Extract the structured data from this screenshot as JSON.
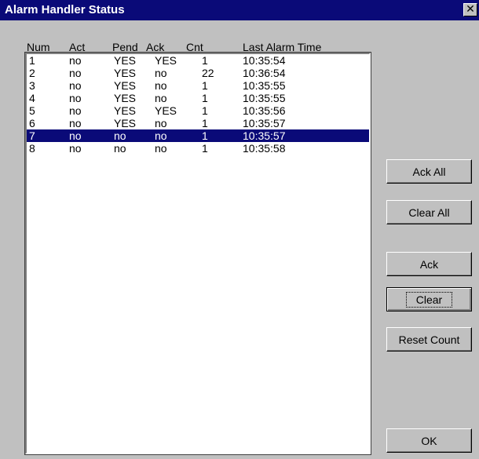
{
  "window": {
    "title": "Alarm Handler Status",
    "close_glyph": "✕"
  },
  "columns": [
    "Num",
    "Act",
    "Pend",
    "Ack",
    "Cnt",
    "Last Alarm Time"
  ],
  "rows": [
    {
      "num": "1",
      "act": "no",
      "pend": "YES",
      "ack": "YES",
      "cnt": "1",
      "time": "10:35:54"
    },
    {
      "num": "2",
      "act": "no",
      "pend": "YES",
      "ack": "no",
      "cnt": "22",
      "time": "10:36:54"
    },
    {
      "num": "3",
      "act": "no",
      "pend": "YES",
      "ack": "no",
      "cnt": "1",
      "time": "10:35:55"
    },
    {
      "num": "4",
      "act": "no",
      "pend": "YES",
      "ack": "no",
      "cnt": "1",
      "time": "10:35:55"
    },
    {
      "num": "5",
      "act": "no",
      "pend": "YES",
      "ack": "YES",
      "cnt": "1",
      "time": "10:35:56"
    },
    {
      "num": "6",
      "act": "no",
      "pend": "YES",
      "ack": "no",
      "cnt": "1",
      "time": "10:35:57"
    },
    {
      "num": "7",
      "act": "no",
      "pend": "no",
      "ack": "no",
      "cnt": "1",
      "time": "10:35:57"
    },
    {
      "num": "8",
      "act": "no",
      "pend": "no",
      "ack": "no",
      "cnt": "1",
      "time": "10:35:58"
    }
  ],
  "selected_row": "7",
  "buttons": {
    "ack_all": "Ack All",
    "clear_all": "Clear All",
    "ack": "Ack",
    "clear": "Clear",
    "reset_count": "Reset Count",
    "ok": "OK"
  },
  "colors": {
    "titlebar": "#0a0a78",
    "selection": "#0a0a78",
    "face": "#c0c0c0"
  }
}
